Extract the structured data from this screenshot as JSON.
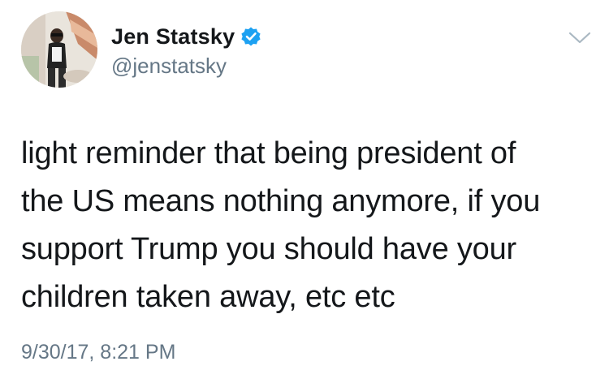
{
  "author": {
    "display_name": "Jen Statsky",
    "handle": "@jenstatsky",
    "verified": true,
    "avatar_icon": "profile-photo"
  },
  "tweet": {
    "text_lines": [
      "light reminder that being president of",
      "the US means nothing anymore, if you",
      "support Trump you should have your",
      "children taken away, etc etc"
    ],
    "timestamp": "9/30/17, 8:21 PM"
  },
  "colors": {
    "text": "#14171a",
    "secondary_text": "#657786",
    "verified_blue": "#1da1f2",
    "caret": "#aab8c2"
  },
  "icons": {
    "verified": "verified-badge-icon",
    "menu": "chevron-down-icon"
  }
}
